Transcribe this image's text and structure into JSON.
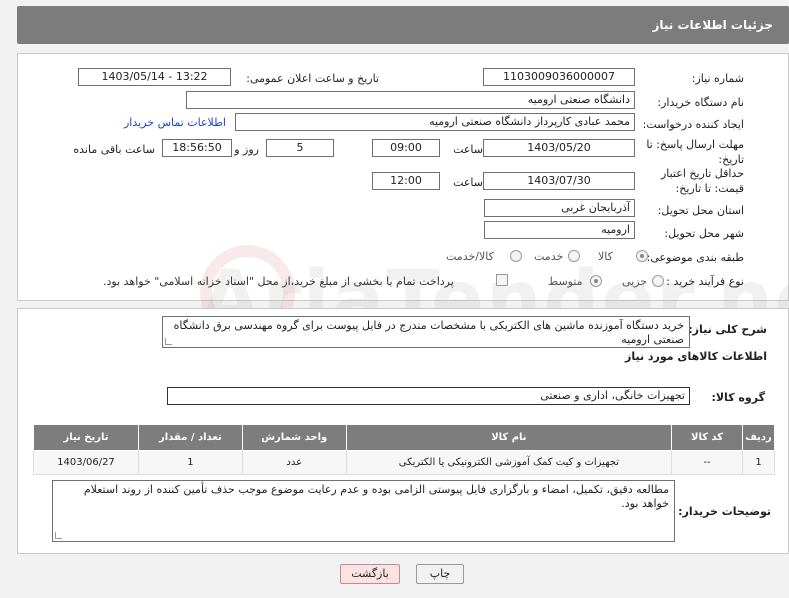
{
  "header": {
    "title": "جزئیات اطلاعات نیاز"
  },
  "form": {
    "need_number_label": "شماره نیاز:",
    "need_number": "1103009036000007",
    "announce_label": "تاریخ و ساعت اعلان عمومی:",
    "announce_value": "1403/05/14 - 13:22",
    "buyer_org_label": "نام دستگاه خریدار:",
    "buyer_org": "دانشگاه صنعتی ارومیه",
    "creator_label": "ایجاد کننده درخواست:",
    "creator": "محمد عبادی کارپرداز دانشگاه صنعتی ارومیه",
    "contact_link": "اطلاعات تماس خریدار",
    "deadline_label": "مهلت ارسال پاسخ: تا تاریخ:",
    "deadline_date": "1403/05/20",
    "time_label": "ساعت",
    "deadline_time": "09:00",
    "days_value": "5",
    "days_label": "روز و",
    "remaining_value": "18:56:50",
    "remaining_label": "ساعت باقی مانده",
    "validity_label": "حداقل تاریخ اعتبار قیمت: تا تاریخ:",
    "validity_date": "1403/07/30",
    "validity_time": "12:00",
    "province_label": "استان محل تحویل:",
    "province": "آذربایجان غربی",
    "city_label": "شهر محل تحویل:",
    "city": "ارومیه",
    "category_label": "طبقه بندی موضوعی:",
    "category_options": [
      "کالا",
      "خدمت",
      "کالا/خدمت"
    ],
    "process_label": "نوع فرآیند خرید :",
    "process_options": [
      "جزیی",
      "متوسط"
    ],
    "payment_note": "پرداخت تمام یا بخشی از مبلغ خرید،از محل \"اسناد خزانه اسلامی\" خواهد بود."
  },
  "description": {
    "label": "شرح کلی نیاز:",
    "text": "خرید دستگاه آموزنده ماشین های الکتریکی با مشخصات مندرج در فایل پیوست برای گروه مهندسی برق دانشگاه صنعتی ارومیه"
  },
  "goods": {
    "title": "اطلاعات کالاهای مورد نیاز",
    "group_label": "گروه کالا:",
    "group_value": "تجهیزات خانگی، اداری و صنعتی",
    "columns": [
      "ردیف",
      "کد کالا",
      "نام کالا",
      "واحد شمارش",
      "تعداد / مقدار",
      "تاریخ نیاز"
    ],
    "rows": [
      [
        "1",
        "--",
        "تجهیزات و کیت کمک آموزشی الکترونیکی یا الکتریکی",
        "عدد",
        "1",
        "1403/06/27"
      ]
    ]
  },
  "buyer_notes": {
    "label": "توضیحات خریدار:",
    "text": "مطالعه دقیق، تکمیل، امضاء و بارگزاری فایل پیوستی الزامی بوده و عدم رعایت موضوع موجب حذف تأمین کننده از روند استعلام خواهد بود."
  },
  "buttons": {
    "print": "چاپ",
    "back": "بازگشت"
  },
  "colors": {
    "header_bg": "#7c7c7c",
    "link": "#1a46c8",
    "back_button": "#fbe3e3"
  }
}
